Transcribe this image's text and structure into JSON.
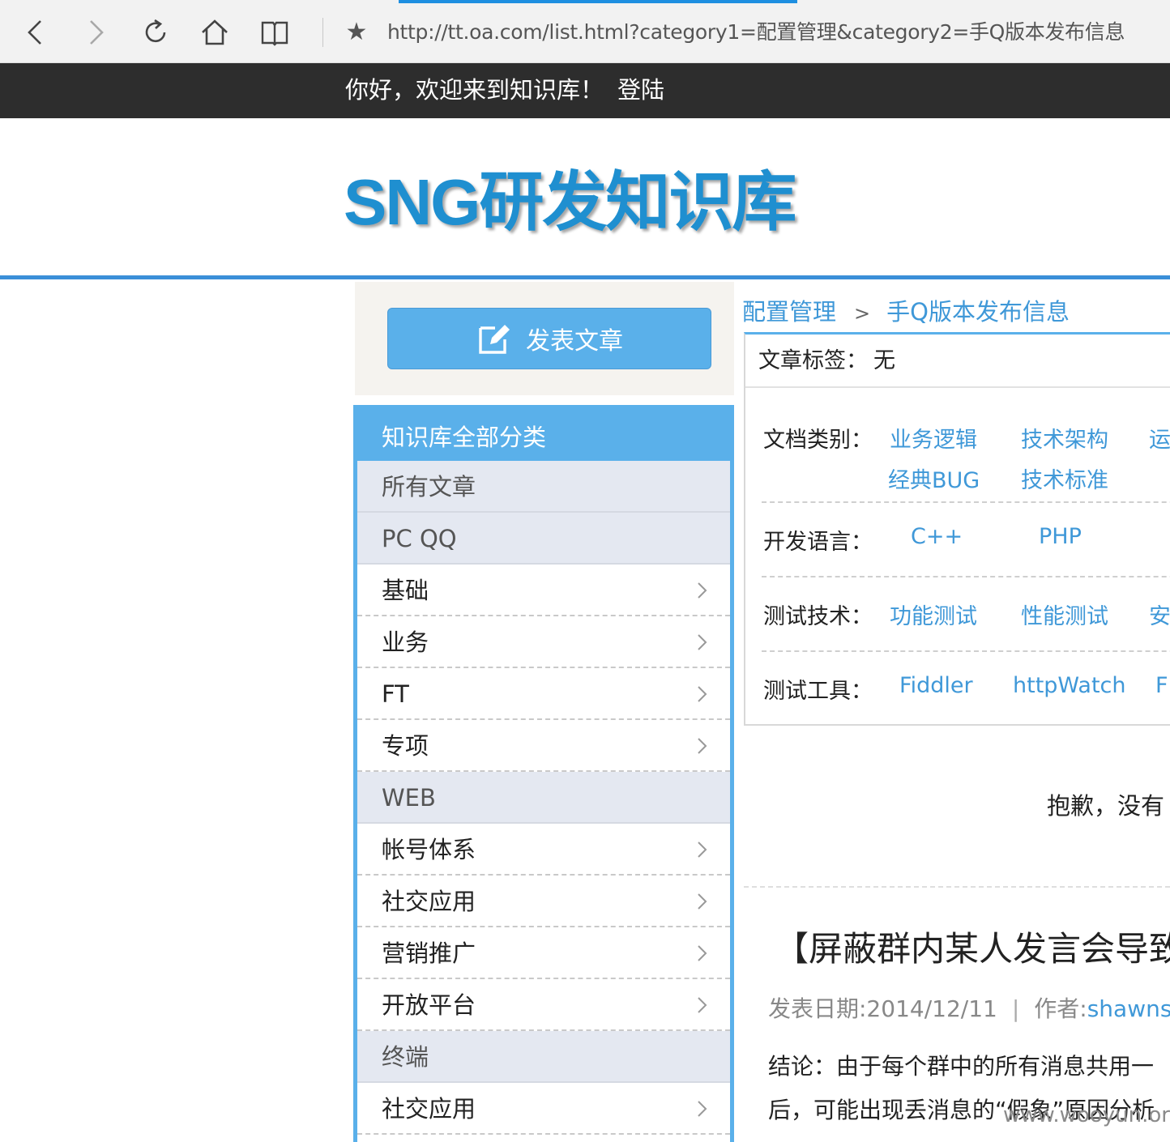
{
  "browser": {
    "url": "http://tt.oa.com/list.html?category1=配置管理&category2=手Q版本发布信息",
    "star": "★"
  },
  "topbar": {
    "welcome": "你好，欢迎来到知识库！",
    "login": "登陆"
  },
  "logo": {
    "text": "SNG研发知识库"
  },
  "sidebar": {
    "publish_label": "发表文章",
    "header": "知识库全部分类",
    "items": [
      {
        "label": "所有文章",
        "group": true
      },
      {
        "label": "PC QQ",
        "group": true
      },
      {
        "label": "基础",
        "group": false
      },
      {
        "label": "业务",
        "group": false
      },
      {
        "label": "FT",
        "group": false
      },
      {
        "label": "专项",
        "group": false
      },
      {
        "label": "WEB",
        "group": true
      },
      {
        "label": "帐号体系",
        "group": false
      },
      {
        "label": "社交应用",
        "group": false
      },
      {
        "label": "营销推广",
        "group": false
      },
      {
        "label": "开放平台",
        "group": false
      },
      {
        "label": "终端",
        "group": true
      },
      {
        "label": "社交应用",
        "group": false
      }
    ]
  },
  "breadcrumb": {
    "level1": "配置管理",
    "sep": ">",
    "level2": "手Q版本发布信息"
  },
  "filters": {
    "tag_label": "文章标签：",
    "tag_value": "无",
    "doc_type": {
      "label": "文档类别：",
      "options": [
        "业务逻辑",
        "技术架构",
        "运",
        "经典BUG",
        "技术标准"
      ]
    },
    "language": {
      "label": "开发语言：",
      "options": [
        "C++",
        "PHP"
      ]
    },
    "test_tech": {
      "label": "测试技术：",
      "options": [
        "功能测试",
        "性能测试",
        "安"
      ]
    },
    "test_tools": {
      "label": "测试工具：",
      "options": [
        "Fiddler",
        "httpWatch",
        "F"
      ]
    }
  },
  "results": {
    "sorry": "抱歉，没有"
  },
  "article": {
    "title": "【屏蔽群内某人发言会导致",
    "date": "发表日期:2014/12/11",
    "meta_sep": "|",
    "author_label": "作者:",
    "author": "shawnsc",
    "line1": "结论：由于每个群中的所有消息共用一",
    "line2": "后，可能出现丢消息的“假象”原因分析"
  },
  "watermark": "www.wooyun.org",
  "colors": {
    "accent": "#5ab0ea",
    "link": "#3f98d8",
    "topbar": "#2d2d2d",
    "logo": "#1f8fd0"
  }
}
